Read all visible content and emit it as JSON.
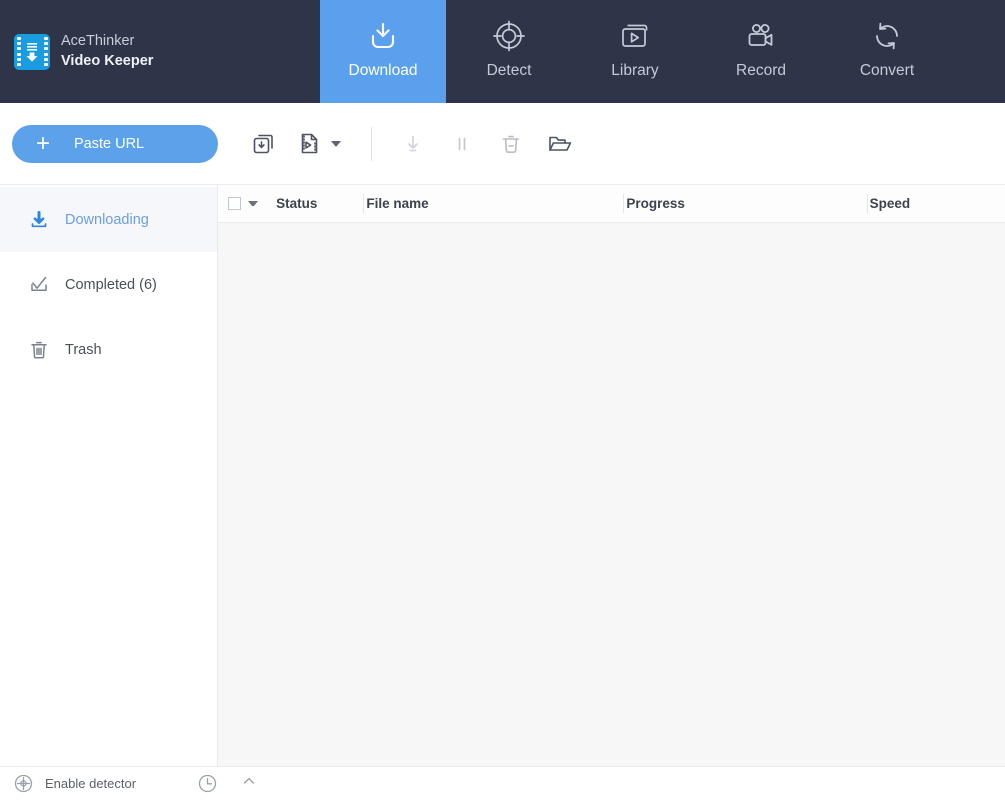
{
  "app": {
    "brand_line1": "AceThinker",
    "brand_line2": "Video Keeper",
    "logo_icon": "video-download-logo-icon",
    "accent_blue": "#5ba0ec",
    "header_bg": "#2e3548"
  },
  "nav": {
    "tabs": [
      {
        "label": "Download",
        "icon": "download-tray-icon",
        "active": true
      },
      {
        "label": "Detect",
        "icon": "crosshair-target-icon",
        "active": false
      },
      {
        "label": "Library",
        "icon": "media-library-play-icon",
        "active": false
      },
      {
        "label": "Record",
        "icon": "video-camera-icon",
        "active": false
      },
      {
        "label": "Convert",
        "icon": "convert-refresh-icon",
        "active": false
      }
    ]
  },
  "toolbar": {
    "paste_url_label": "Paste URL",
    "plus_glyph": "+",
    "batch_download_icon": "batch-download-icon",
    "video_file_icon": "video-file-icon",
    "video_file_caret": "chevron-down-icon",
    "start_icon": "start-download-arrow-icon",
    "pause_icon": "pause-icon",
    "delete_icon": "trash-delete-icon",
    "open_folder_icon": "open-folder-icon"
  },
  "sidebar": {
    "items": [
      {
        "label": "Downloading",
        "icon": "download-icon",
        "active": true
      },
      {
        "label": "Completed (6)",
        "icon": "check-complete-icon",
        "active": false
      },
      {
        "label": "Trash",
        "icon": "trash-icon",
        "active": false
      }
    ]
  },
  "table": {
    "select_all_checked": false,
    "columns": [
      {
        "key": "status",
        "label": "Status"
      },
      {
        "key": "file_name",
        "label": "File name"
      },
      {
        "key": "progress",
        "label": "Progress"
      },
      {
        "key": "speed",
        "label": "Speed"
      }
    ],
    "rows": []
  },
  "statusbar": {
    "detector_label": "Enable detector",
    "detector_icon": "crosshair-detector-icon",
    "schedule_icon": "clock-schedule-icon",
    "expand_icon": "chevron-up-icon"
  }
}
